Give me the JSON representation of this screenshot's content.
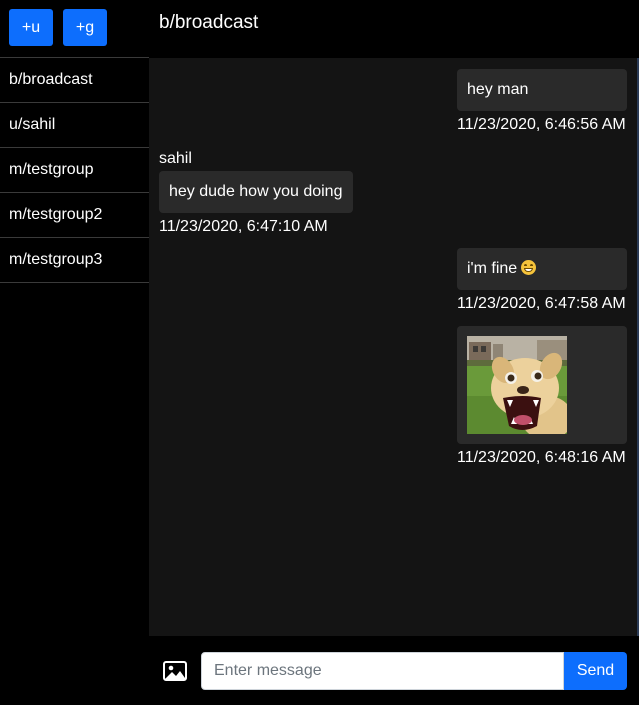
{
  "sidebar": {
    "add_user_label": "+u",
    "add_group_label": "+g",
    "items": [
      {
        "label": "b/broadcast"
      },
      {
        "label": "u/sahil"
      },
      {
        "label": "m/testgroup"
      },
      {
        "label": "m/testgroup2"
      },
      {
        "label": "m/testgroup3"
      }
    ]
  },
  "header": {
    "title": "b/broadcast"
  },
  "messages": [
    {
      "direction": "outgoing",
      "text": "hey man",
      "timestamp": "11/23/2020, 6:46:56 AM"
    },
    {
      "direction": "incoming",
      "sender": "sahil",
      "text": "hey dude how you doing",
      "timestamp": "11/23/2020, 6:47:10 AM"
    },
    {
      "direction": "outgoing",
      "text": "i'm fine",
      "emoji": "grinning-face-icon",
      "timestamp": "11/23/2020, 6:47:58 AM"
    },
    {
      "direction": "outgoing",
      "type": "image",
      "image": "dog-photo",
      "timestamp": "11/23/2020, 6:48:16 AM"
    }
  ],
  "composer": {
    "attach_icon": "image-icon",
    "placeholder": "Enter message",
    "value": "",
    "send_label": "Send"
  },
  "colors": {
    "accent": "#0d6efd",
    "bubble": "#2a2a2a",
    "messages_bg": "#141414",
    "background": "#000000"
  }
}
